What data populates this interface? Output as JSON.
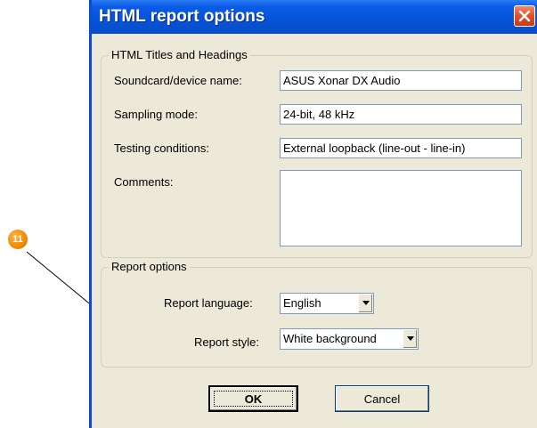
{
  "dialog": {
    "title": "HTML report options",
    "close_icon": "close-icon"
  },
  "titles_group": {
    "legend": "HTML Titles and Headings",
    "device_label": "Soundcard/device name:",
    "device_value": "ASUS Xonar DX Audio",
    "sampling_label": "Sampling mode:",
    "sampling_value": "24-bit, 48 kHz",
    "testing_label": "Testing conditions:",
    "testing_value": "External loopback (line-out - line-in)",
    "comments_label": "Comments:",
    "comments_value": ""
  },
  "report_group": {
    "legend": "Report options",
    "language_label": "Report language:",
    "language_value": "English",
    "style_label": "Report style:",
    "style_value": "White background"
  },
  "buttons": {
    "ok": "OK",
    "cancel": "Cancel"
  },
  "callout": {
    "number": "11",
    "color": "#f08a00"
  }
}
